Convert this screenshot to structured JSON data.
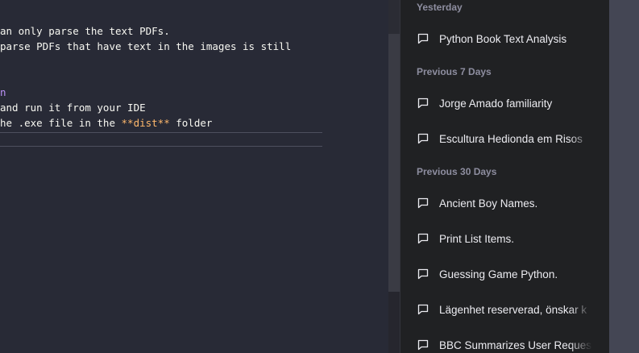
{
  "editor": {
    "lines": [
      {
        "segments": [
          {
            "text": "an only parse the text PDFs.",
            "cls": ""
          }
        ]
      },
      {
        "segments": [
          {
            "text": "parse PDFs that have text in the images is still",
            "cls": ""
          }
        ]
      },
      {
        "segments": [
          {
            "text": "",
            "cls": ""
          }
        ]
      },
      {
        "segments": [
          {
            "text": "",
            "cls": ""
          }
        ]
      },
      {
        "segments": [
          {
            "text": "n",
            "cls": "purple"
          }
        ]
      },
      {
        "segments": [
          {
            "text": "and run it from your IDE",
            "cls": ""
          }
        ]
      },
      {
        "segments": [
          {
            "text": "he .exe file in the ",
            "cls": ""
          },
          {
            "text": "**dist**",
            "cls": "orange"
          },
          {
            "text": " folder",
            "cls": ""
          }
        ]
      }
    ]
  },
  "sidebar": {
    "sections": [
      {
        "heading": "Yesterday",
        "items": [
          "Python Book Text Analysis"
        ]
      },
      {
        "heading": "Previous 7 Days",
        "items": [
          "Jorge Amado familiarity",
          "Escultura Hedionda em Risos"
        ]
      },
      {
        "heading": "Previous 30 Days",
        "items": [
          "Ancient Boy Names.",
          "Print List Items.",
          "Guessing Game Python.",
          "Lägenhet reserverad, önskar k",
          "BBC Summarizes User Reques"
        ]
      }
    ],
    "item_icon": "chat-bubble-icon"
  }
}
